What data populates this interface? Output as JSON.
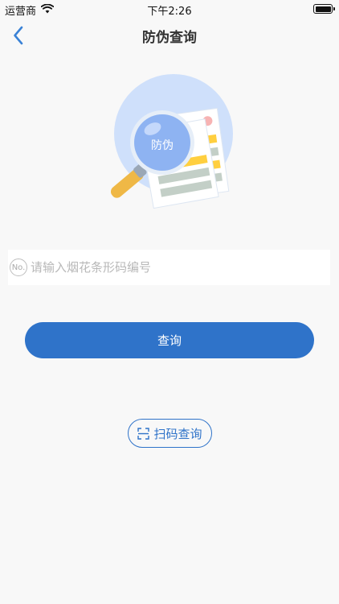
{
  "status_bar": {
    "carrier": "运营商",
    "time": "下午2:26"
  },
  "nav": {
    "title": "防伪查询"
  },
  "illustration": {
    "label": "防伪"
  },
  "search": {
    "badge": "No.",
    "placeholder": "请输入烟花条形码编号"
  },
  "actions": {
    "query_label": "查询",
    "scan_label": "扫码查询"
  },
  "colors": {
    "primary": "#2f73c9",
    "background": "#f8f8f8",
    "circle": "#cfe0fb"
  }
}
